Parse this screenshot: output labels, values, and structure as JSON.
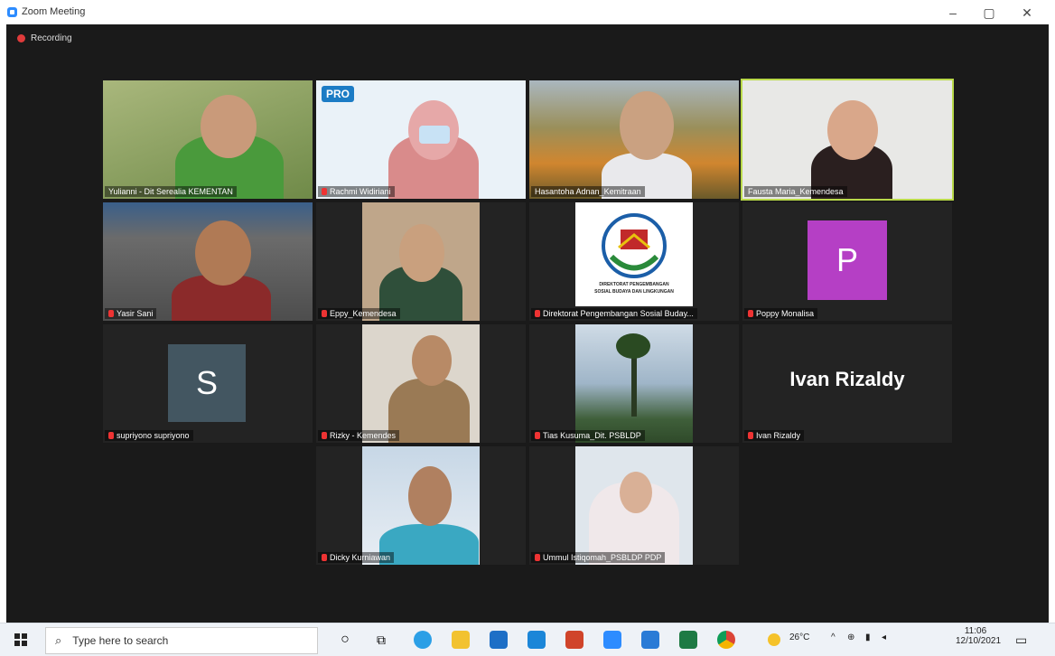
{
  "window": {
    "title": "Zoom Meeting"
  },
  "recording_label": "Recording",
  "participants": [
    {
      "name": "Yulianni - Dit Serealia KEMENTAN"
    },
    {
      "name": "Rachmi Widiriani"
    },
    {
      "name": "Hasantoha Adnan_Kemitraan"
    },
    {
      "name": "Fausta Maria_Kemendesa"
    },
    {
      "name": "Yasir Sani"
    },
    {
      "name": "Eppy_Kemendesa"
    },
    {
      "name": "Direktorat Pengembangan Sosial Buday..."
    },
    {
      "name": "Poppy Monalisa",
      "initial": "P"
    },
    {
      "name": "supriyono supriyono",
      "initial": "S"
    },
    {
      "name": "Rizky - Kemendes"
    },
    {
      "name": "Tias Kusuma_Dit. PSBLDP"
    },
    {
      "name": "Ivan Rizaldy",
      "display": "Ivan Rizaldy"
    },
    {
      "name": "Dicky Kurniawan"
    },
    {
      "name": "Ummul Istiqomah_PSBLDP PDP"
    }
  ],
  "banner": {
    "logo_text": "PRO"
  },
  "logo": {
    "line1": "DIREKTORAT PENGEMBANGAN",
    "line2": "SOSIAL BUDAYA DAN LINGKUNGAN"
  },
  "colors": {
    "active_border": "#b9d94a",
    "stage": "#1a1a1a",
    "avatar_p": "#b53fc5",
    "avatar_s": "#435661"
  },
  "taskbar": {
    "search_placeholder": "Type here to search",
    "weather": "26°C",
    "time": "11:06",
    "date": "12/10/2021"
  }
}
